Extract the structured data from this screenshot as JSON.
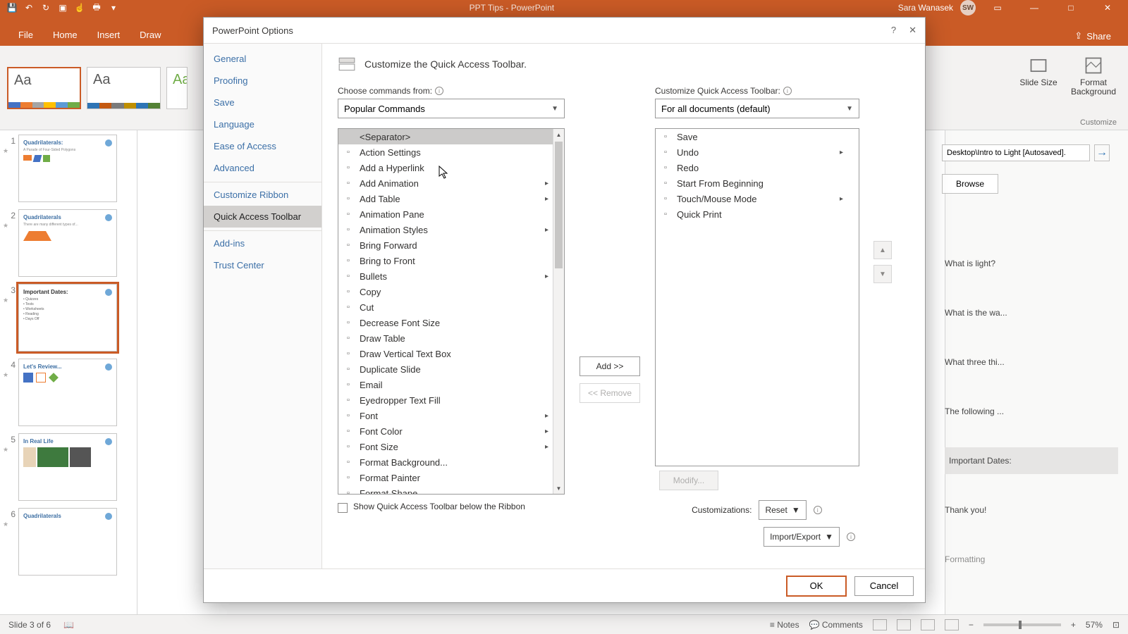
{
  "titlebar": {
    "doc": "PPT Tips  -  PowerPoint",
    "user": "Sara Wanasek",
    "badge": "SW"
  },
  "ribbon": {
    "tabs": [
      "File",
      "Home",
      "Insert",
      "Draw"
    ],
    "share": "Share",
    "slide_size": "Slide Size",
    "format_bg": "Format Background",
    "group": "Customize"
  },
  "statusbar": {
    "slide": "Slide 3 of 6",
    "notes": "Notes",
    "comments": "Comments",
    "zoom": "57%"
  },
  "path": "Desktop\\Intro to Light [Autosaved].",
  "browse": "Browse",
  "reuse": [
    "What is light?",
    "What is the wa...",
    "What three thi...",
    "The following ...",
    "Important Dates:",
    "Thank you!",
    "Formatting"
  ],
  "dialog": {
    "title": "PowerPoint Options",
    "nav": [
      "General",
      "Proofing",
      "Save",
      "Language",
      "Ease of Access",
      "Advanced",
      "Customize Ribbon",
      "Quick Access Toolbar",
      "Add-ins",
      "Trust Center"
    ],
    "heading": "Customize the Quick Access Toolbar.",
    "left_label": "Choose commands from:",
    "left_select": "Popular Commands",
    "right_label": "Customize Quick Access Toolbar:",
    "right_select": "For all documents (default)",
    "commands": [
      "<Separator>",
      "Action Settings",
      "Add a Hyperlink",
      "Add Animation",
      "Add Table",
      "Animation Pane",
      "Animation Styles",
      "Bring Forward",
      "Bring to Front",
      "Bullets",
      "Copy",
      "Cut",
      "Decrease Font Size",
      "Draw Table",
      "Draw Vertical Text Box",
      "Duplicate Slide",
      "Email",
      "Eyedropper Text Fill",
      "Font",
      "Font Color",
      "Font Size",
      "Format Background...",
      "Format Painter",
      "Format Shape"
    ],
    "qat_items": [
      "Save",
      "Undo",
      "Redo",
      "Start From Beginning",
      "Touch/Mouse Mode",
      "Quick Print"
    ],
    "add": "Add >>",
    "remove": "<< Remove",
    "show_below": "Show Quick Access Toolbar below the Ribbon",
    "customizations": "Customizations:",
    "reset": "Reset",
    "import_export": "Import/Export",
    "modify": "Modify...",
    "ok": "OK",
    "cancel": "Cancel"
  },
  "slides": [
    {
      "n": "1",
      "t": "Quadrilaterals:"
    },
    {
      "n": "2",
      "t": "Quadrilaterals"
    },
    {
      "n": "3",
      "t": "Important Dates:"
    },
    {
      "n": "4",
      "t": "Let's Review..."
    },
    {
      "n": "5",
      "t": "In Real Life"
    },
    {
      "n": "6",
      "t": "Quadrilaterals"
    }
  ]
}
